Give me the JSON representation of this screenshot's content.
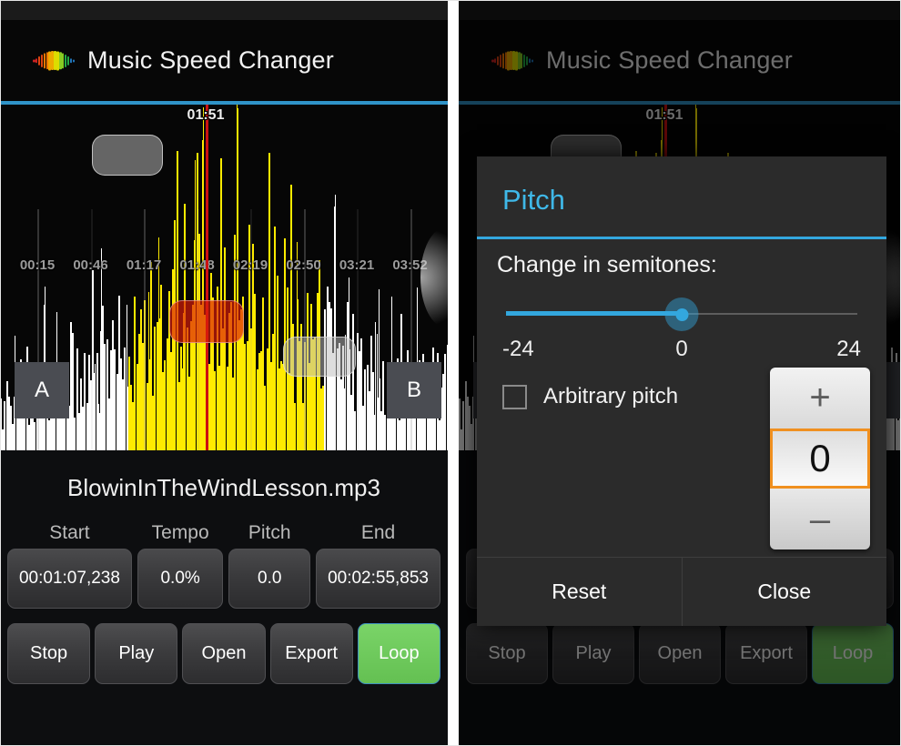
{
  "app": {
    "title": "Music Speed Changer",
    "logo_icon": "rainbow-waveform-icon",
    "accent_blue": "#33a7de",
    "loop_green": "#6ecb5a",
    "picker_orange": "#f09020",
    "waveform_yellow": "#ffeb00",
    "playhead_red": "#cc1111"
  },
  "waveform": {
    "playhead_label": "01:51",
    "time_ticks": [
      "00:15",
      "00:46",
      "01:17",
      "01:48",
      "02:19",
      "02:50",
      "03:21",
      "03:52"
    ],
    "marker_a": "A",
    "marker_b": "B",
    "handle_left_icon": "drag-handle-icon",
    "handle_right_icon": "drag-handle-icon",
    "selection_icon": "loop-selection-icon",
    "edge_glow_icon": "scroll-edge-glow-icon"
  },
  "track": {
    "filename": "BlowinInTheWindLesson.mp3",
    "fields": [
      {
        "label": "Start",
        "value": "00:01:07,238"
      },
      {
        "label": "Tempo",
        "value": "0.0%"
      },
      {
        "label": "Pitch",
        "value": "0.0"
      },
      {
        "label": "End",
        "value": "00:02:55,853"
      }
    ]
  },
  "actions": [
    {
      "label": "Stop",
      "state": "normal"
    },
    {
      "label": "Play",
      "state": "normal"
    },
    {
      "label": "Open",
      "state": "normal"
    },
    {
      "label": "Export",
      "state": "normal"
    },
    {
      "label": "Loop",
      "state": "active"
    }
  ],
  "dialog": {
    "title": "Pitch",
    "subtitle": "Change in semitones:",
    "slider": {
      "min_label": "-24",
      "value_label": "0",
      "max_label": "24",
      "value": 0,
      "min": -24,
      "max": 24
    },
    "checkbox": {
      "label": "Arbitrary pitch",
      "checked": false
    },
    "picker": {
      "increment_icon": "plus-icon",
      "value": "0",
      "decrement_icon": "minus-icon"
    },
    "buttons": [
      {
        "label": "Reset"
      },
      {
        "label": "Close"
      }
    ]
  }
}
